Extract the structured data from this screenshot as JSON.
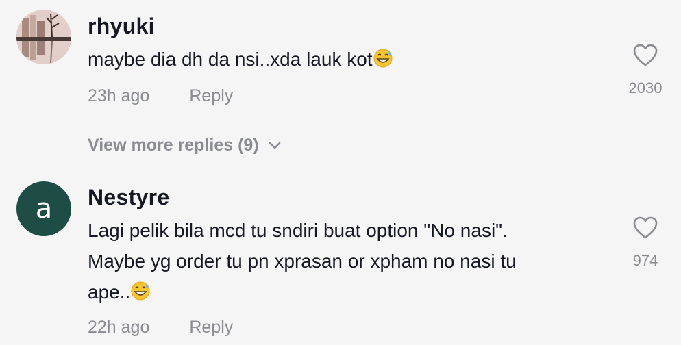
{
  "comments": [
    {
      "username": "rhyuki",
      "avatar": "photo-avatar",
      "text": "maybe dia dh da nsi..xda lauk kot",
      "emoji": "grinning-sweat-emoji",
      "time": "23h ago",
      "reply_label": "Reply",
      "likes": "2030",
      "view_more": "View more replies (9)"
    },
    {
      "username": "Nestyre",
      "avatar_letter": "a",
      "text_lines": [
        "Lagi pelik bila mcd tu sndiri buat option \"No nasi\".",
        "Maybe yg order tu pn xprasan or xpham no nasi tu",
        "ape.."
      ],
      "emoji": "grinning-sweat-emoji",
      "time": "22h ago",
      "reply_label": "Reply",
      "likes": "974"
    }
  ],
  "colors": {
    "background": "#f5f5f5",
    "primary_text": "#161823",
    "secondary_text": "#8a8b91",
    "avatar_green": "#1e4d45"
  }
}
